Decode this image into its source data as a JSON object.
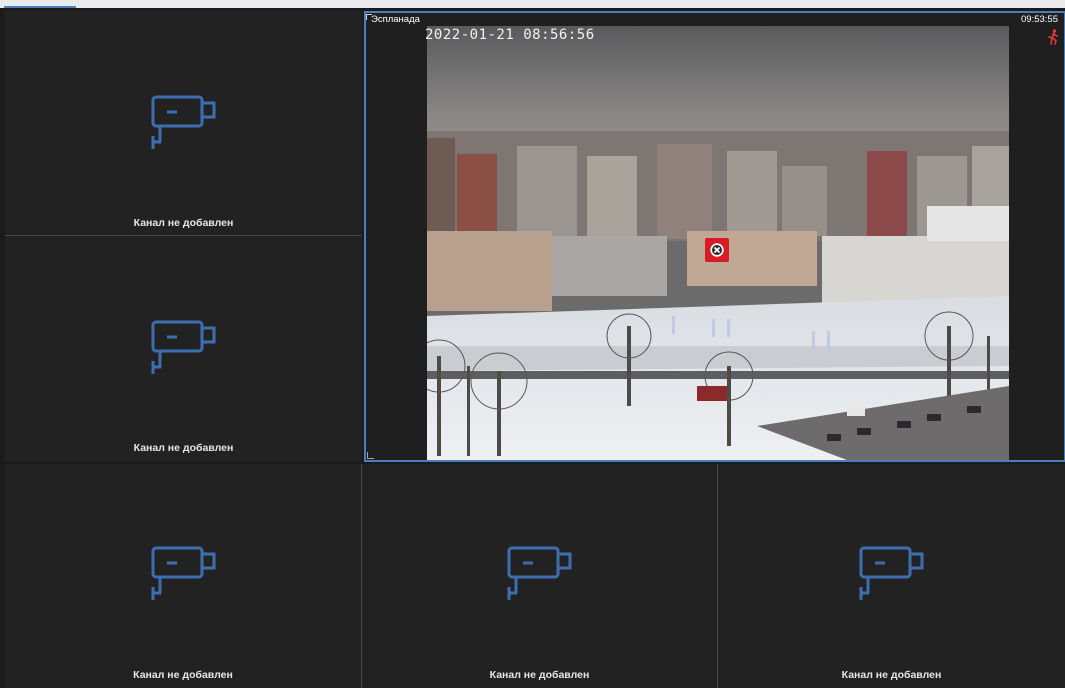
{
  "empty_label": "Канал не добавлен",
  "live_channel": {
    "name": "Эспланада",
    "time": "09:53:55",
    "osd_timestamp": "2022-01-21 08:56:56"
  },
  "icons": {
    "placeholder": "camera-icon",
    "motion": "running-person-icon",
    "close": "close-circle-icon"
  },
  "colors": {
    "accent": "#4a7fbf",
    "icon": "#3d6fb0",
    "close": "#d81b24",
    "motion": "#e53935",
    "cell_bg": "#222222"
  },
  "cells": [
    {
      "label": "Канал не добавлен"
    },
    {
      "label": "Канал не добавлен"
    },
    {
      "label": "Канал не добавлен"
    },
    {
      "label": "Канал не добавлен"
    },
    {
      "label": "Канал не добавлен"
    }
  ]
}
